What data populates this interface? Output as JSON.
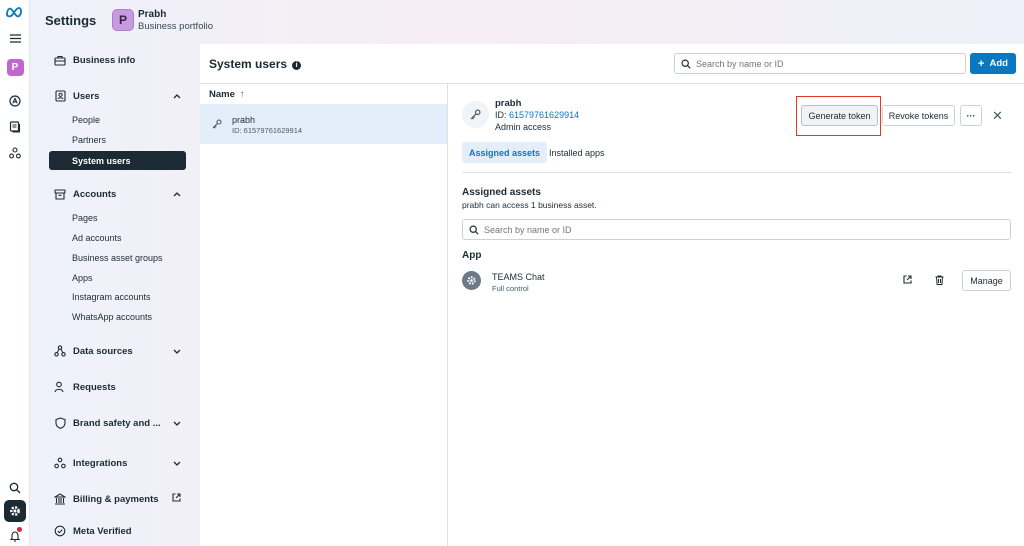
{
  "rail": {
    "items": [
      "meta-logo-icon",
      "menu-icon",
      "portfolio-avatar",
      "ads-icon",
      "pages-icon",
      "audience-icon",
      "search-icon",
      "settings-icon",
      "notifications-icon"
    ],
    "avatar_letter": "P"
  },
  "header": {
    "title": "Settings",
    "portfolio_letter": "P",
    "portfolio_name": "Prabh",
    "portfolio_subtitle": "Business portfolio"
  },
  "sidebar": {
    "business_info": "Business info",
    "users": {
      "label": "Users",
      "items": [
        "People",
        "Partners",
        "System users"
      ]
    },
    "accounts": {
      "label": "Accounts",
      "items": [
        "Pages",
        "Ad accounts",
        "Business asset groups",
        "Apps",
        "Instagram accounts",
        "WhatsApp accounts"
      ]
    },
    "data_sources": "Data sources",
    "requests": "Requests",
    "brand_safety": "Brand safety and ...",
    "integrations": "Integrations",
    "billing": "Billing & payments",
    "meta_verified": "Meta Verified"
  },
  "panel": {
    "title": "System users",
    "search_placeholder": "Search by name or ID",
    "add_label": "Add",
    "list_header": "Name",
    "list": [
      {
        "name": "prabh",
        "id": "ID: 61579761629914"
      }
    ]
  },
  "detail": {
    "name": "prabh",
    "id_prefix": "ID: ",
    "id_value": "61579761629914",
    "role": "Admin access",
    "generate_label": "Generate token",
    "revoke_label": "Revoke tokens",
    "more_label": "···",
    "tabs": [
      "Assigned assets",
      "Installed apps"
    ],
    "assets_title": "Assigned assets",
    "assets_subtitle": "prabh can access 1 business asset.",
    "asset_search_placeholder": "Search by name or ID",
    "app_heading": "App",
    "app": {
      "name": "TEAMS Chat",
      "permission": "Full control"
    },
    "manage_label": "Manage"
  },
  "colors": {
    "accent": "#0a78be",
    "dark": "#1c2b33",
    "highlight_border": "#e0382d",
    "selected_row": "#e4eefa"
  }
}
